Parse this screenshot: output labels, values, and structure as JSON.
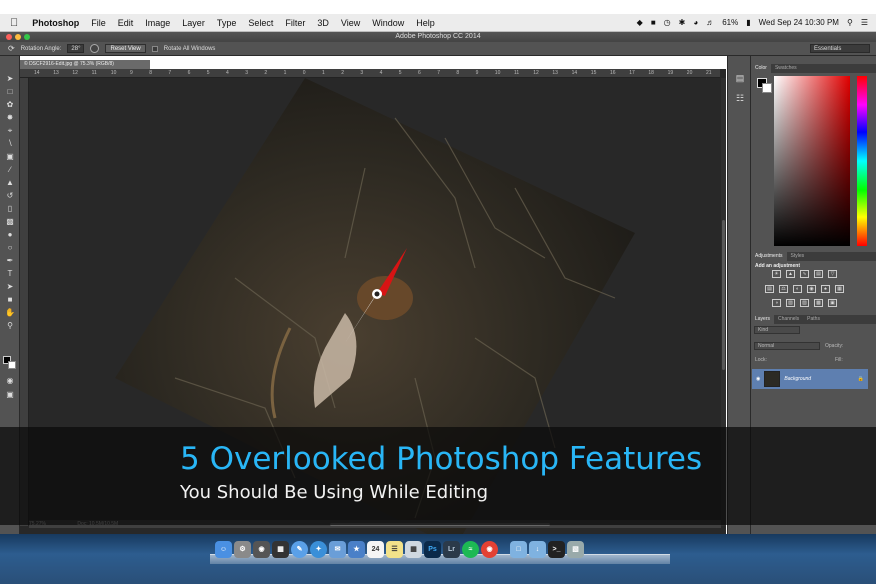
{
  "menubar": {
    "app": "Photoshop",
    "items": [
      "File",
      "Edit",
      "Image",
      "Layer",
      "Type",
      "Select",
      "Filter",
      "3D",
      "View",
      "Window",
      "Help"
    ],
    "battery": "61%",
    "clock": "Wed Sep 24  10:30 PM"
  },
  "window": {
    "title": "Adobe Photoshop CC 2014"
  },
  "options": {
    "rotation_label": "Rotation Angle:",
    "rotation_value": "28°",
    "reset_label": "Reset View",
    "rotate_all_label": "Rotate All Windows",
    "workspace": "Essentials"
  },
  "document": {
    "tab": "© DSCF2916-Edit.jpg @ 75.3% (RGB/8)",
    "zoom": "75.27%",
    "doc_size": "Doc: 10.5M/10.5M",
    "ruler_ticks": [
      "14",
      "13",
      "12",
      "11",
      "10",
      "9",
      "8",
      "7",
      "6",
      "5",
      "4",
      "3",
      "2",
      "1",
      "0",
      "1",
      "2",
      "3",
      "4",
      "5",
      "6",
      "7",
      "8",
      "9",
      "10",
      "11",
      "12",
      "13",
      "14",
      "15",
      "16",
      "17",
      "18",
      "19",
      "20",
      "21"
    ]
  },
  "panels": {
    "color_tabs": [
      "Color",
      "Swatches"
    ],
    "adjust_tabs": [
      "Adjustments",
      "Styles"
    ],
    "add_adjustment": "Add an adjustment",
    "layer_tabs": [
      "Layers",
      "Channels",
      "Paths"
    ],
    "kind": "Kind",
    "blend_mode": "Normal",
    "opacity_label": "Opacity:",
    "lock_label": "Lock:",
    "fill_label": "Fill:",
    "layer_name": "Background"
  },
  "banner": {
    "headline": "5 Overlooked Photoshop Features",
    "subline": "You Should Be Using While Editing"
  },
  "colors": {
    "headline": "#29b6f6",
    "ui_panel": "#535353",
    "canvas_bg": "#282828",
    "layer_selected": "#5e7fb0"
  },
  "dock_icons": [
    "finder",
    "system-preferences",
    "photo-booth",
    "piano",
    "messages",
    "safari",
    "mail",
    "iphoto",
    "calendar",
    "notes",
    "preview",
    "photoshop",
    "lightroom",
    "spotify",
    "chrome",
    "folder",
    "downloads",
    "terminal",
    "trash"
  ]
}
